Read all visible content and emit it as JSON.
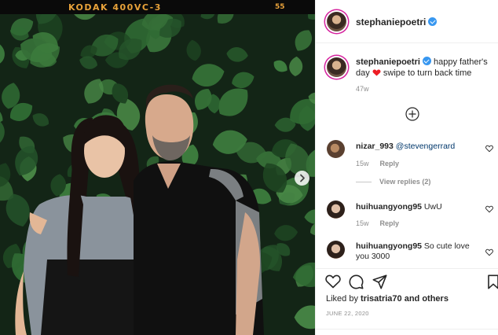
{
  "photo": {
    "film_brand": "KODAK 400VC-3",
    "film_number": "55",
    "next_icon": "chevron-right-icon"
  },
  "post": {
    "author": "stephaniepoetri",
    "verified": true,
    "caption_text_1": "happy father's day",
    "caption_emoji": "red-heart-icon",
    "caption_text_2": "swipe to turn back time",
    "caption_age": "47w"
  },
  "load_more_icon": "plus-circle-icon",
  "comments": [
    {
      "user": "nizar_993",
      "text": "@stevengerrard",
      "age": "15w",
      "reply_label": "Reply",
      "view_replies": "View replies (2)"
    },
    {
      "user": "huihuangyong95",
      "text": "UwU",
      "age": "15w",
      "reply_label": "Reply"
    },
    {
      "user": "huihuangyong95",
      "text": "So cute love",
      "text_2": "you 3000"
    }
  ],
  "actions": {
    "like_icon": "heart-icon",
    "comment_icon": "comment-icon",
    "share_icon": "send-icon",
    "save_icon": "bookmark-icon",
    "likes_prefix": "Liked by",
    "likes_user": "trisatria70",
    "likes_suffix": "and others",
    "date": "JUNE 22, 2020"
  },
  "colors": {
    "link_blue": "#00376b",
    "verified_blue": "#3897f0",
    "story_ring": "#d6249f",
    "caption_heart": "#ed1c24",
    "film_text": "#e8a23a"
  }
}
